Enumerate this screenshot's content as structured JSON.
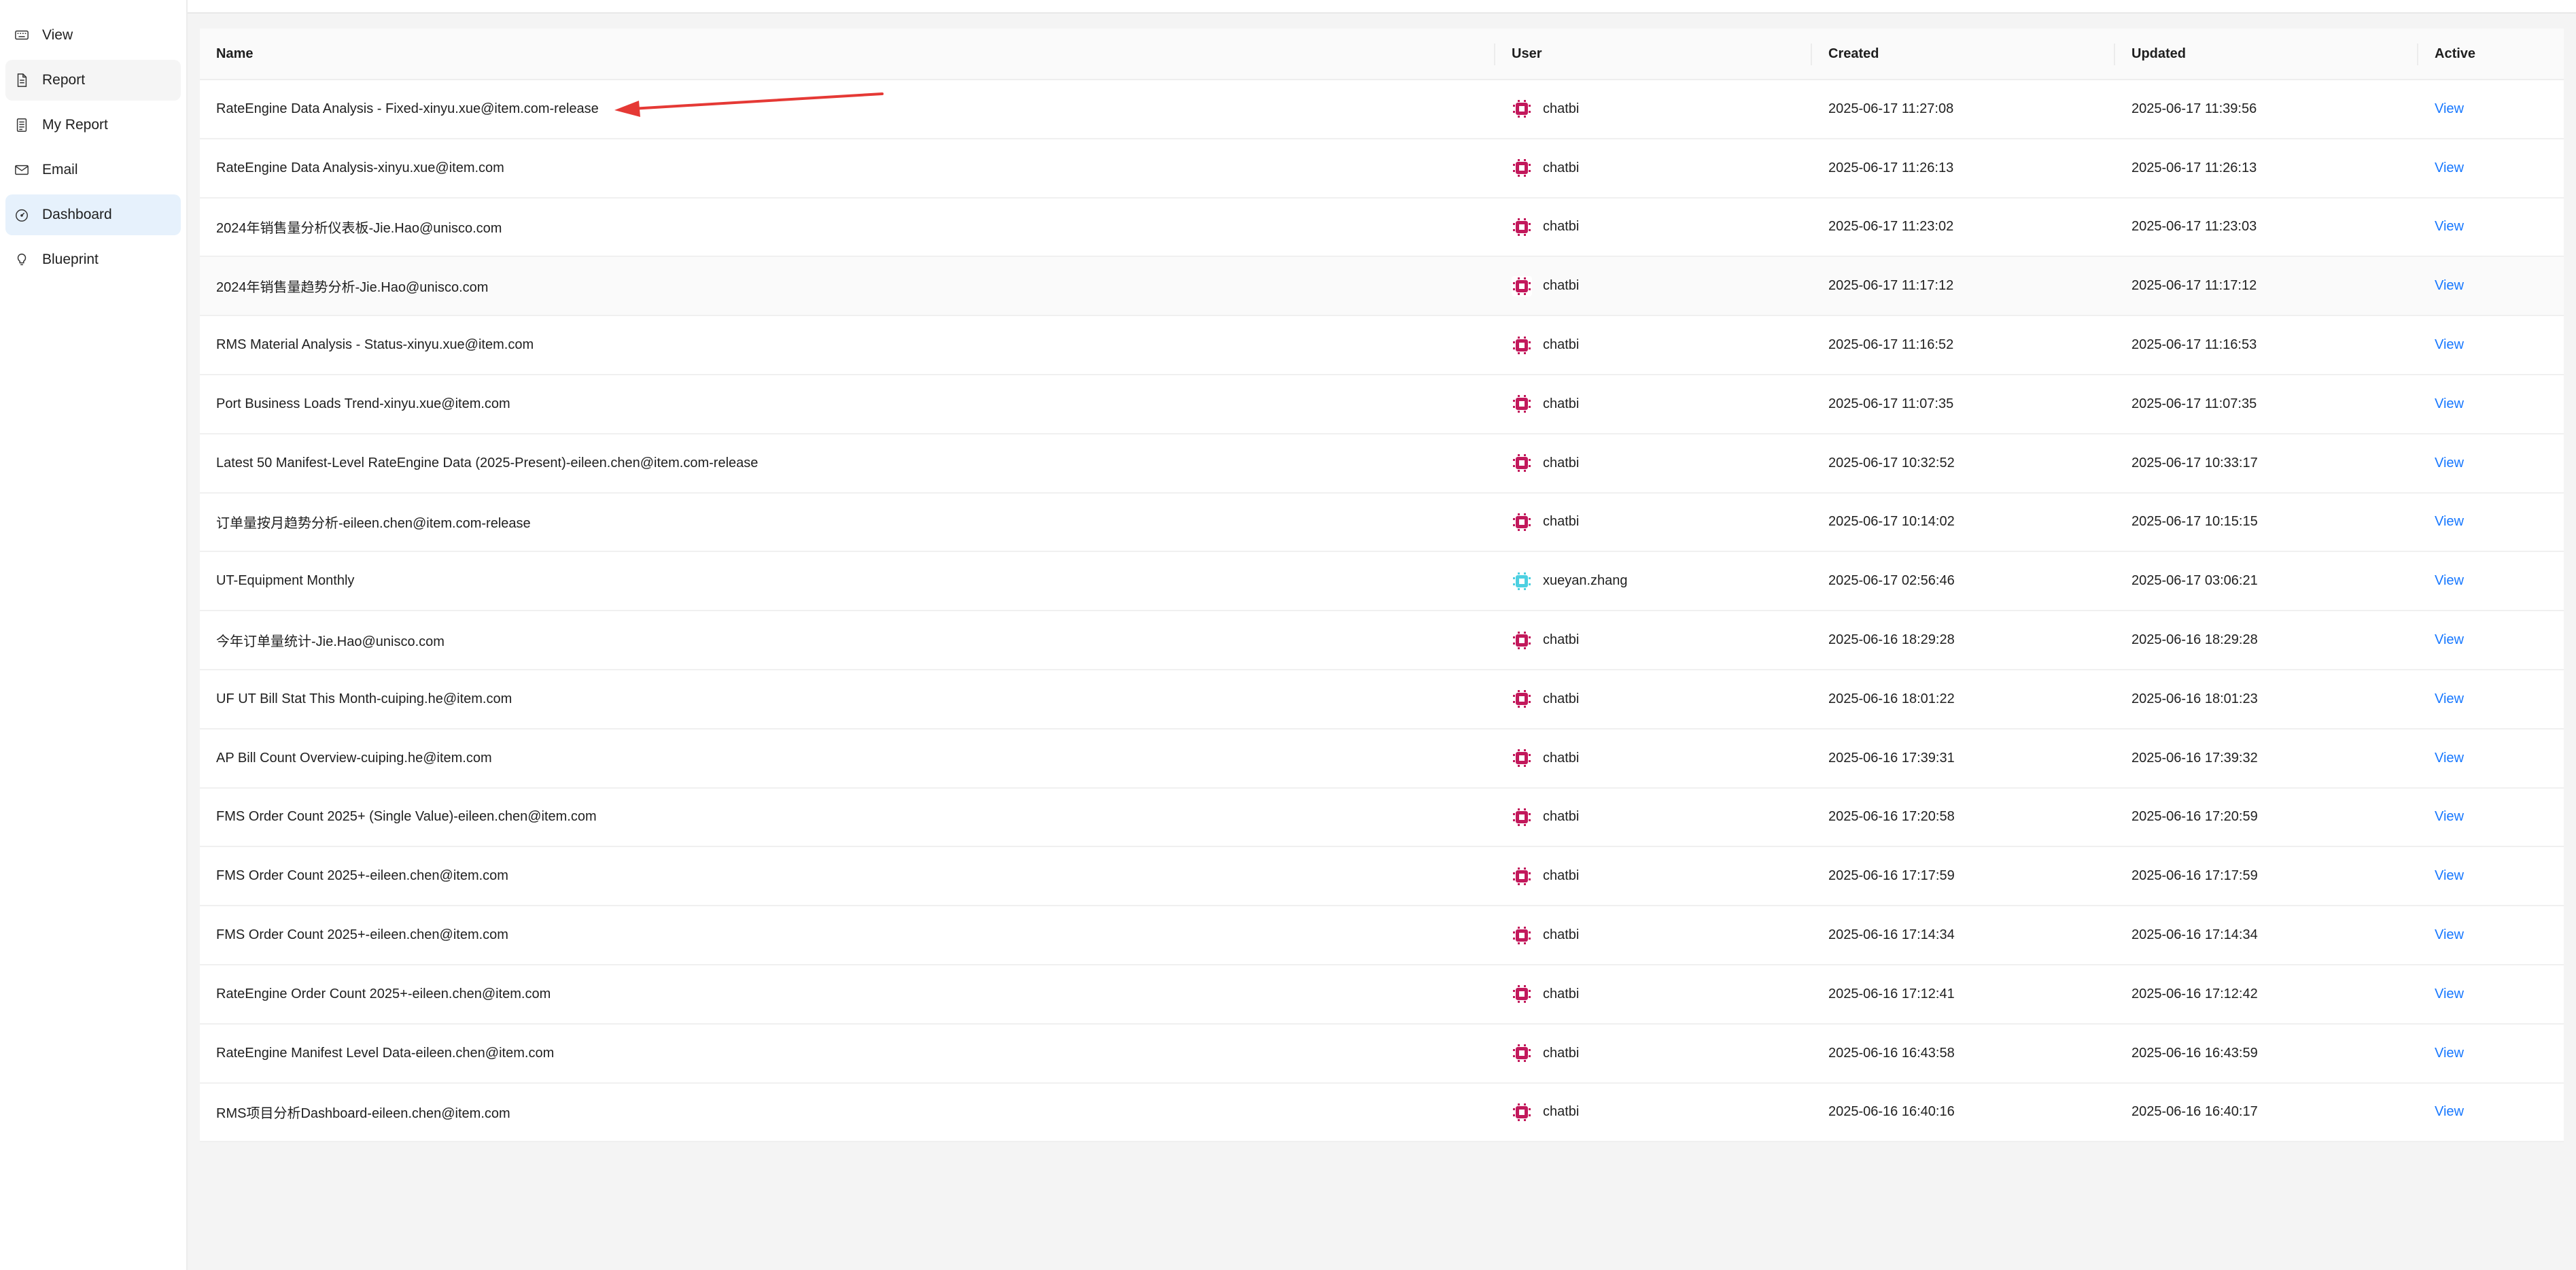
{
  "sidebar": {
    "items": [
      {
        "label": "View",
        "icon": "keyboard-icon"
      },
      {
        "label": "Report",
        "icon": "document-icon"
      },
      {
        "label": "My Report",
        "icon": "list-document-icon"
      },
      {
        "label": "Email",
        "icon": "mail-icon"
      },
      {
        "label": "Dashboard",
        "icon": "dashboard-gauge-icon"
      },
      {
        "label": "Blueprint",
        "icon": "lightbulb-icon"
      }
    ],
    "active_index": 4
  },
  "table": {
    "headers": {
      "name": "Name",
      "user": "User",
      "created": "Created",
      "updated": "Updated",
      "active": "Active"
    },
    "rows": [
      {
        "name": "RateEngine Data Analysis - Fixed-xinyu.xue@item.com-release",
        "user": "chatbi",
        "avatar": "pink",
        "created": "2025-06-17 11:27:08",
        "updated": "2025-06-17 11:39:56",
        "action": "View"
      },
      {
        "name": "RateEngine Data Analysis-xinyu.xue@item.com",
        "user": "chatbi",
        "avatar": "pink",
        "created": "2025-06-17 11:26:13",
        "updated": "2025-06-17 11:26:13",
        "action": "View"
      },
      {
        "name": "2024年销售量分析仪表板-Jie.Hao@unisco.com",
        "user": "chatbi",
        "avatar": "pink",
        "created": "2025-06-17 11:23:02",
        "updated": "2025-06-17 11:23:03",
        "action": "View"
      },
      {
        "name": "2024年销售量趋势分析-Jie.Hao@unisco.com",
        "user": "chatbi",
        "avatar": "pink",
        "created": "2025-06-17 11:17:12",
        "updated": "2025-06-17 11:17:12",
        "action": "View"
      },
      {
        "name": "RMS Material Analysis - Status-xinyu.xue@item.com",
        "user": "chatbi",
        "avatar": "pink",
        "created": "2025-06-17 11:16:52",
        "updated": "2025-06-17 11:16:53",
        "action": "View"
      },
      {
        "name": "Port Business Loads Trend-xinyu.xue@item.com",
        "user": "chatbi",
        "avatar": "pink",
        "created": "2025-06-17 11:07:35",
        "updated": "2025-06-17 11:07:35",
        "action": "View"
      },
      {
        "name": "Latest 50 Manifest-Level RateEngine Data (2025-Present)-eileen.chen@item.com-release",
        "user": "chatbi",
        "avatar": "pink",
        "created": "2025-06-17 10:32:52",
        "updated": "2025-06-17 10:33:17",
        "action": "View"
      },
      {
        "name": "订单量按月趋势分析-eileen.chen@item.com-release",
        "user": "chatbi",
        "avatar": "pink",
        "created": "2025-06-17 10:14:02",
        "updated": "2025-06-17 10:15:15",
        "action": "View"
      },
      {
        "name": "UT-Equipment Monthly",
        "user": "xueyan.zhang",
        "avatar": "cyan",
        "created": "2025-06-17 02:56:46",
        "updated": "2025-06-17 03:06:21",
        "action": "View"
      },
      {
        "name": "今年订单量统计-Jie.Hao@unisco.com",
        "user": "chatbi",
        "avatar": "pink",
        "created": "2025-06-16 18:29:28",
        "updated": "2025-06-16 18:29:28",
        "action": "View"
      },
      {
        "name": "UF UT Bill Stat This Month-cuiping.he@item.com",
        "user": "chatbi",
        "avatar": "pink",
        "created": "2025-06-16 18:01:22",
        "updated": "2025-06-16 18:01:23",
        "action": "View"
      },
      {
        "name": "AP Bill Count Overview-cuiping.he@item.com",
        "user": "chatbi",
        "avatar": "pink",
        "created": "2025-06-16 17:39:31",
        "updated": "2025-06-16 17:39:32",
        "action": "View"
      },
      {
        "name": "FMS Order Count 2025+ (Single Value)-eileen.chen@item.com",
        "user": "chatbi",
        "avatar": "pink",
        "created": "2025-06-16 17:20:58",
        "updated": "2025-06-16 17:20:59",
        "action": "View"
      },
      {
        "name": "FMS Order Count 2025+-eileen.chen@item.com",
        "user": "chatbi",
        "avatar": "pink",
        "created": "2025-06-16 17:17:59",
        "updated": "2025-06-16 17:17:59",
        "action": "View"
      },
      {
        "name": "FMS Order Count 2025+-eileen.chen@item.com",
        "user": "chatbi",
        "avatar": "pink",
        "created": "2025-06-16 17:14:34",
        "updated": "2025-06-16 17:14:34",
        "action": "View"
      },
      {
        "name": "RateEngine Order Count 2025+-eileen.chen@item.com",
        "user": "chatbi",
        "avatar": "pink",
        "created": "2025-06-16 17:12:41",
        "updated": "2025-06-16 17:12:42",
        "action": "View"
      },
      {
        "name": "RateEngine Manifest Level Data-eileen.chen@item.com",
        "user": "chatbi",
        "avatar": "pink",
        "created": "2025-06-16 16:43:58",
        "updated": "2025-06-16 16:43:59",
        "action": "View"
      },
      {
        "name": "RMS项目分析Dashboard-eileen.chen@item.com",
        "user": "chatbi",
        "avatar": "pink",
        "created": "2025-06-16 16:40:16",
        "updated": "2025-06-16 16:40:17",
        "action": "View"
      }
    ],
    "hovered_row_index": 3
  },
  "colors": {
    "link": "#1677ff",
    "active_nav_bg": "#e6f1fc",
    "avatar_pink": "#c2185b",
    "avatar_cyan": "#4dd0e1",
    "annotation_arrow": "#e53935"
  }
}
